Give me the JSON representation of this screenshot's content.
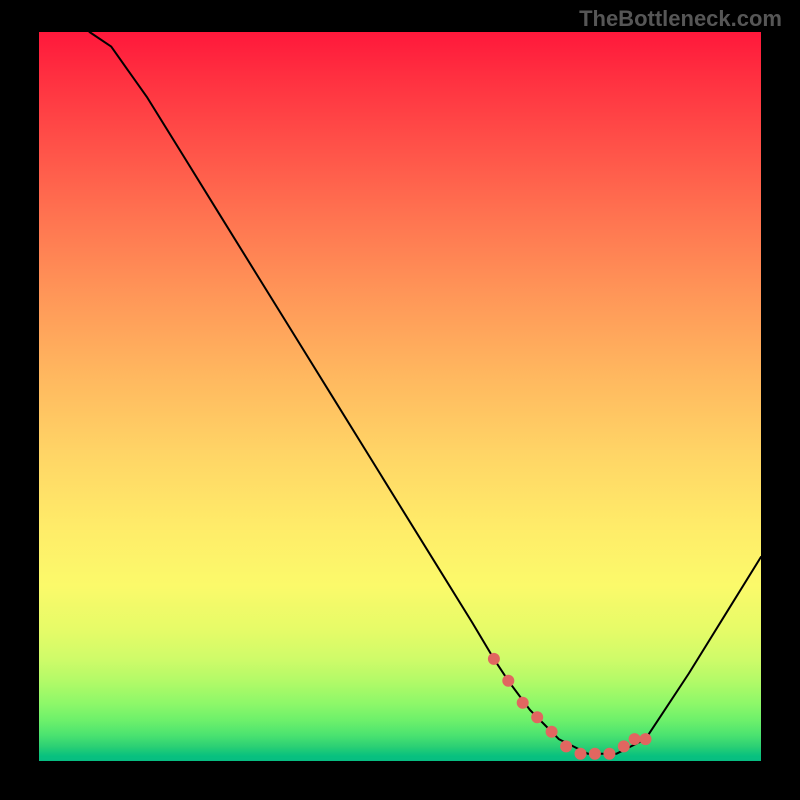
{
  "attribution": "TheBottleneck.com",
  "colors": {
    "background": "#000000",
    "marker": "#e16660",
    "curve": "#000000",
    "gradient_top": "#ff183b",
    "gradient_bottom": "#07bd82"
  },
  "chart_data": {
    "type": "line",
    "title": "",
    "xlabel": "",
    "ylabel": "",
    "xlim": [
      0,
      100
    ],
    "ylim": [
      0,
      100
    ],
    "series": [
      {
        "name": "bottleneck-curve",
        "x": [
          7,
          10,
          15,
          20,
          25,
          30,
          35,
          40,
          45,
          50,
          55,
          60,
          63,
          65,
          68,
          70,
          72,
          74,
          76,
          78,
          80,
          82,
          84,
          86,
          90,
          95,
          100
        ],
        "y": [
          100,
          98,
          91,
          83,
          75,
          67,
          59,
          51,
          43,
          35,
          27,
          19,
          14,
          11,
          7,
          5,
          3,
          2,
          1,
          1,
          1,
          2,
          3,
          6,
          12,
          20,
          28
        ]
      }
    ],
    "markers": {
      "name": "optimal-range",
      "x": [
        63,
        65,
        67,
        69,
        71,
        73,
        75,
        77,
        79,
        81,
        82.5,
        84
      ],
      "y": [
        14,
        11,
        8,
        6,
        4,
        2,
        1,
        1,
        1,
        2,
        3,
        3
      ]
    },
    "annotations": []
  }
}
